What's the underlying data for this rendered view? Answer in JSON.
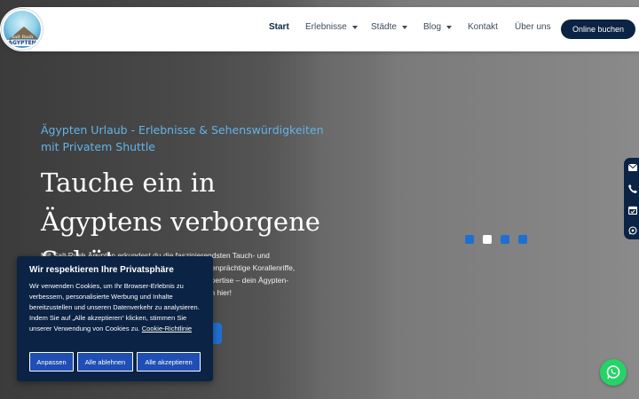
{
  "header": {
    "logo": {
      "line1": "Salt Rush",
      "line2": "ÄGYPTEN"
    },
    "nav": [
      {
        "label": "Start",
        "active": true
      },
      {
        "label": "Erlebnisse",
        "dropdown": true
      },
      {
        "label": "Städte",
        "dropdown": true
      },
      {
        "label": "Blog",
        "dropdown": true
      },
      {
        "label": "Kontakt"
      },
      {
        "label": "Über uns"
      }
    ],
    "cta_label": "Online buchen"
  },
  "hero": {
    "subtitle": "Ägypten Urlaub - Erlebnisse & Sehenswürdigkeiten mit Privatem Shuttle",
    "title": "Tauche ein in Ägyptens verborgene Schätze",
    "body_lines": [
      "Mit Salt Rush Ägypten erkundest du die faszinierendsten Tauch- und",
      "Schnorchelspots des Roten Meeres. Entdecke farbenprächtige Korallenriffe,",
      "geheimnisvolle Wracks und vertraue auf unsere Expertise – dein Ägypten-",
      "Abenteuer kann mit uns in besten Händen beginnen hier!"
    ],
    "slider": {
      "count": 4,
      "active_index": 1
    }
  },
  "side_contacts": [
    "envelope-icon",
    "phone-icon",
    "calendar-icon",
    "whatsapp-icon"
  ],
  "cookie": {
    "title": "Wir respektieren Ihre Privatsphäre",
    "text": "Wir verwenden Cookies, um Ihr Browser-Erlebnis zu verbessern, personalisierte Werbung und Inhalte bereitzustellen und unseren Datenverkehr zu analysieren. Indem Sie auf „Alle akzeptieren“ klicken, stimmen Sie unserer Verwendung von Cookies zu.",
    "link_label": "Cookie-Richtlinie",
    "buttons": [
      "Anpassen",
      "Alle ablehnen",
      "Alle akzeptieren"
    ]
  },
  "colors": {
    "navy": "#0b2344",
    "accent_blue": "#1f6fd0",
    "subtitle_blue": "#62b4e8",
    "whatsapp_green": "#25d366"
  }
}
